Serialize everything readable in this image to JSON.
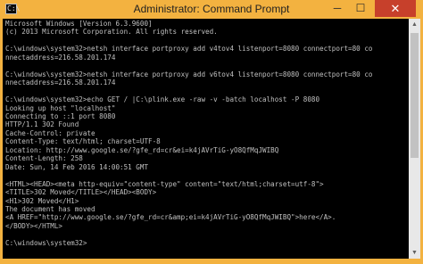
{
  "window": {
    "title": "Administrator: Command Prompt",
    "icon_glyph": "C:\\",
    "controls": {
      "minimize": "─",
      "maximize": "☐",
      "close": "✕"
    }
  },
  "console": {
    "lines": [
      "Microsoft Windows [Version 6.3.9600]",
      "(c) 2013 Microsoft Corporation. All rights reserved.",
      "",
      "C:\\windows\\system32>netsh interface portproxy add v4tov4 listenport=8080 connectport=80 co",
      "nnectaddress=216.58.201.174",
      "",
      "C:\\windows\\system32>netsh interface portproxy add v6tov4 listenport=8080 connectport=80 co",
      "nnectaddress=216.58.201.174",
      "",
      "C:\\windows\\system32>echo GET / |C:\\plink.exe -raw -v -batch localhost -P 8080",
      "Looking up host \"localhost\"",
      "Connecting to ::1 port 8080",
      "HTTP/1.1 302 Found",
      "Cache-Control: private",
      "Content-Type: text/html; charset=UTF-8",
      "Location: http://www.google.se/?gfe_rd=cr&ei=k4jAVrTiG-yO8QfMqJWIBQ",
      "Content-Length: 258",
      "Date: Sun, 14 Feb 2016 14:00:51 GMT",
      "",
      "<HTML><HEAD><meta http-equiv=\"content-type\" content=\"text/html;charset=utf-8\">",
      "<TITLE>302 Moved</TITLE></HEAD><BODY>",
      "<H1>302 Moved</H1>",
      "The document has moved",
      "<A HREF=\"http://www.google.se/?gfe_rd=cr&amp;ei=k4jAVrTiG-yO8QfMqJWIBQ\">here</A>.",
      "</BODY></HTML>",
      "",
      "C:\\windows\\system32>"
    ]
  },
  "colors": {
    "frame": "#f3b240",
    "console_bg": "#000000",
    "console_text": "#c0c0c0",
    "close_button": "#c7402b"
  }
}
